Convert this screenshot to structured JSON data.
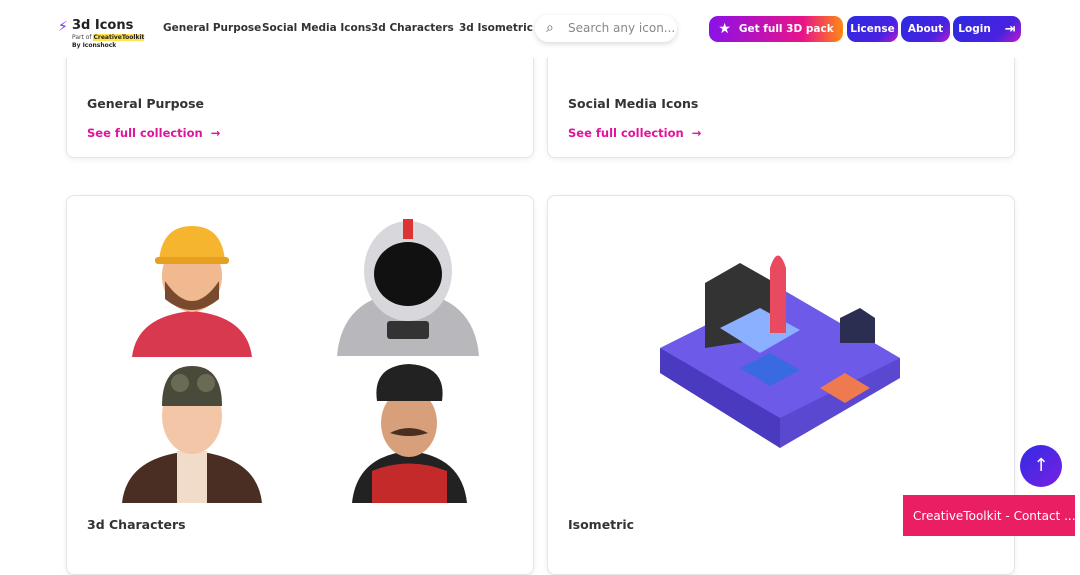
{
  "header": {
    "logo_title": "3d Icons",
    "logo_part_of": "Part of",
    "logo_brand": "CreativeToolkit",
    "logo_by": "By Iconshock",
    "nav": [
      "General Purpose",
      "Social Media Icons",
      "3d Characters",
      "3d Isometric"
    ],
    "search_placeholder": "Search any icon...",
    "buttons": {
      "get_pack": "Get full 3D pack",
      "license": "License",
      "about": "About",
      "login": "Login"
    }
  },
  "cards": [
    {
      "title": "General Purpose",
      "link": "See full collection"
    },
    {
      "title": "Social Media Icons",
      "link": "See full collection"
    },
    {
      "title": "3d Characters"
    },
    {
      "title": "Isometric"
    }
  ],
  "contact": "CreativeToolkit - Contact ...",
  "colors": {
    "accent": "#e0149a",
    "primary": "#2a2be0",
    "contact": "#ea1f63"
  }
}
